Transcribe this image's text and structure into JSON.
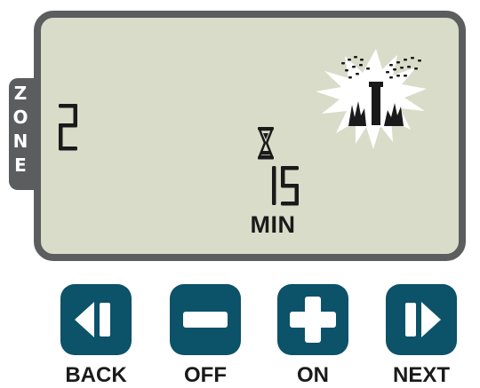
{
  "colors": {
    "lcd_bg": "#d9dcc9",
    "frame": "#5b5d5f",
    "button": "#0c5269",
    "segment": "#1a1a1a"
  },
  "zone": {
    "label_letters": [
      "Z",
      "O",
      "N",
      "E"
    ],
    "number": "2"
  },
  "timer": {
    "icon": "hourglass-icon",
    "value": "15",
    "unit": "MIN"
  },
  "status": {
    "icon": "sprinkler-watering-icon"
  },
  "buttons": [
    {
      "label": "BACK",
      "icon": "back-icon"
    },
    {
      "label": "OFF",
      "icon": "minus-icon"
    },
    {
      "label": "ON",
      "icon": "plus-icon"
    },
    {
      "label": "NEXT",
      "icon": "next-icon"
    }
  ]
}
